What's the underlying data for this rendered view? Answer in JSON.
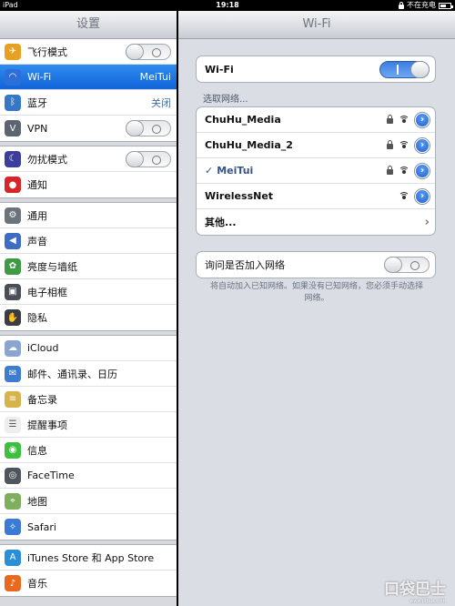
{
  "status_bar": {
    "device": "iPad",
    "time": "19:18",
    "charging": "不在充电"
  },
  "master": {
    "title": "设置",
    "groups": [
      [
        {
          "label": "飞行模式",
          "icon": "airplane-icon",
          "color": "#e8a022",
          "control": "switch-off"
        },
        {
          "label": "Wi-Fi",
          "icon": "wifi-icon",
          "color": "#2d6fd8",
          "value": "MeiTui",
          "selected": true
        },
        {
          "label": "蓝牙",
          "icon": "bluetooth-icon",
          "color": "#3478c6",
          "value": "关闭"
        },
        {
          "label": "VPN",
          "icon": "vpn-icon",
          "color": "#5b6570",
          "control": "switch-off"
        }
      ],
      [
        {
          "label": "勿扰模式",
          "icon": "moon-icon",
          "color": "#3b3f9b",
          "control": "switch-off"
        },
        {
          "label": "通知",
          "icon": "notification-icon",
          "color": "#d6262b"
        }
      ],
      [
        {
          "label": "通用",
          "icon": "gear-icon",
          "color": "#6d737c"
        },
        {
          "label": "声音",
          "icon": "speaker-icon",
          "color": "#3d6cc2"
        },
        {
          "label": "亮度与墙纸",
          "icon": "flower-icon",
          "color": "#3f9b43"
        },
        {
          "label": "电子相框",
          "icon": "picture-frame-icon",
          "color": "#4a4f57"
        },
        {
          "label": "隐私",
          "icon": "hand-icon",
          "color": "#3a3d44"
        }
      ],
      [
        {
          "label": "iCloud",
          "icon": "cloud-icon",
          "color": "#8aa6d0"
        },
        {
          "label": "邮件、通讯录、日历",
          "icon": "mail-icon",
          "color": "#3e7ccf"
        },
        {
          "label": "备忘录",
          "icon": "notes-icon",
          "color": "#d6b44b"
        },
        {
          "label": "提醒事项",
          "icon": "reminders-icon",
          "color": "#eeeeee"
        },
        {
          "label": "信息",
          "icon": "messages-icon",
          "color": "#3fbf3f"
        },
        {
          "label": "FaceTime",
          "icon": "facetime-icon",
          "color": "#4f555c"
        },
        {
          "label": "地图",
          "icon": "map-icon",
          "color": "#7fae5e"
        },
        {
          "label": "Safari",
          "icon": "compass-icon",
          "color": "#3b7bd3"
        }
      ],
      [
        {
          "label": "iTunes Store 和 App Store",
          "icon": "app-store-icon",
          "color": "#2b8fd8"
        },
        {
          "label": "音乐",
          "icon": "music-icon",
          "color": "#e86a21"
        }
      ]
    ]
  },
  "detail": {
    "title": "Wi-Fi",
    "wifi_toggle": {
      "label": "Wi-Fi",
      "on": true
    },
    "choose_network_label": "选取网络...",
    "networks": [
      {
        "name": "ChuHu_Media",
        "locked": true,
        "checked": false
      },
      {
        "name": "ChuHu_Media_2",
        "locked": true,
        "checked": false
      },
      {
        "name": "MeiTui",
        "locked": true,
        "checked": true
      },
      {
        "name": "WirelessNet",
        "locked": false,
        "checked": false
      }
    ],
    "other_label": "其他...",
    "ask_join": {
      "label": "询问是否加入网络",
      "on": false
    },
    "footer": "将自动加入已知网络。如果没有已知网络，您必须手动选择网络。"
  },
  "watermark": {
    "brand": "口袋巴士",
    "site": "www.ptbus.com"
  }
}
